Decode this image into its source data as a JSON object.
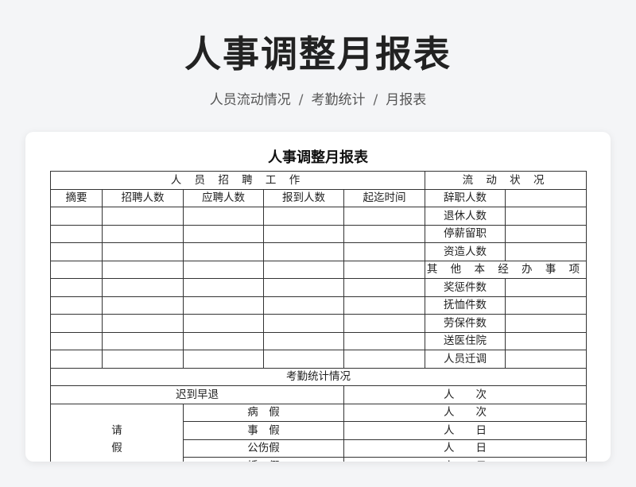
{
  "page": {
    "title": "人事调整月报表",
    "breadcrumb": [
      "人员流动情况",
      "考勤统计",
      "月报表"
    ],
    "breadcrumb_sep": "/"
  },
  "sheet": {
    "title": "人事调整月报表",
    "recruit_header": "人 员 招 聘 工 作",
    "flow_header": "流 动 状 况",
    "columns": [
      "摘要",
      "招聘人数",
      "应聘人数",
      "报到人数",
      "起迄时间"
    ],
    "flow_items": [
      "辞职人数",
      "退休人数",
      "停薪留职",
      "资造人数"
    ],
    "other_header": "其 他 本 经 办 事 项",
    "other_items": [
      "奖惩件数",
      "抚恤件数",
      "劳保件数",
      "送医住院",
      "人员迁调"
    ],
    "attendance_header": "考勤统计情况",
    "late_label": "迟到早退",
    "late_unit": "人　　次",
    "leave_label": [
      "请",
      "假"
    ],
    "leave_rows": [
      {
        "type": "病　假",
        "unit": "人　　次"
      },
      {
        "type": "事　假",
        "unit": "人　　日"
      },
      {
        "type": "公伤假",
        "unit": "人　　日"
      },
      {
        "type": "婚　假",
        "unit": "人　　日"
      }
    ]
  }
}
